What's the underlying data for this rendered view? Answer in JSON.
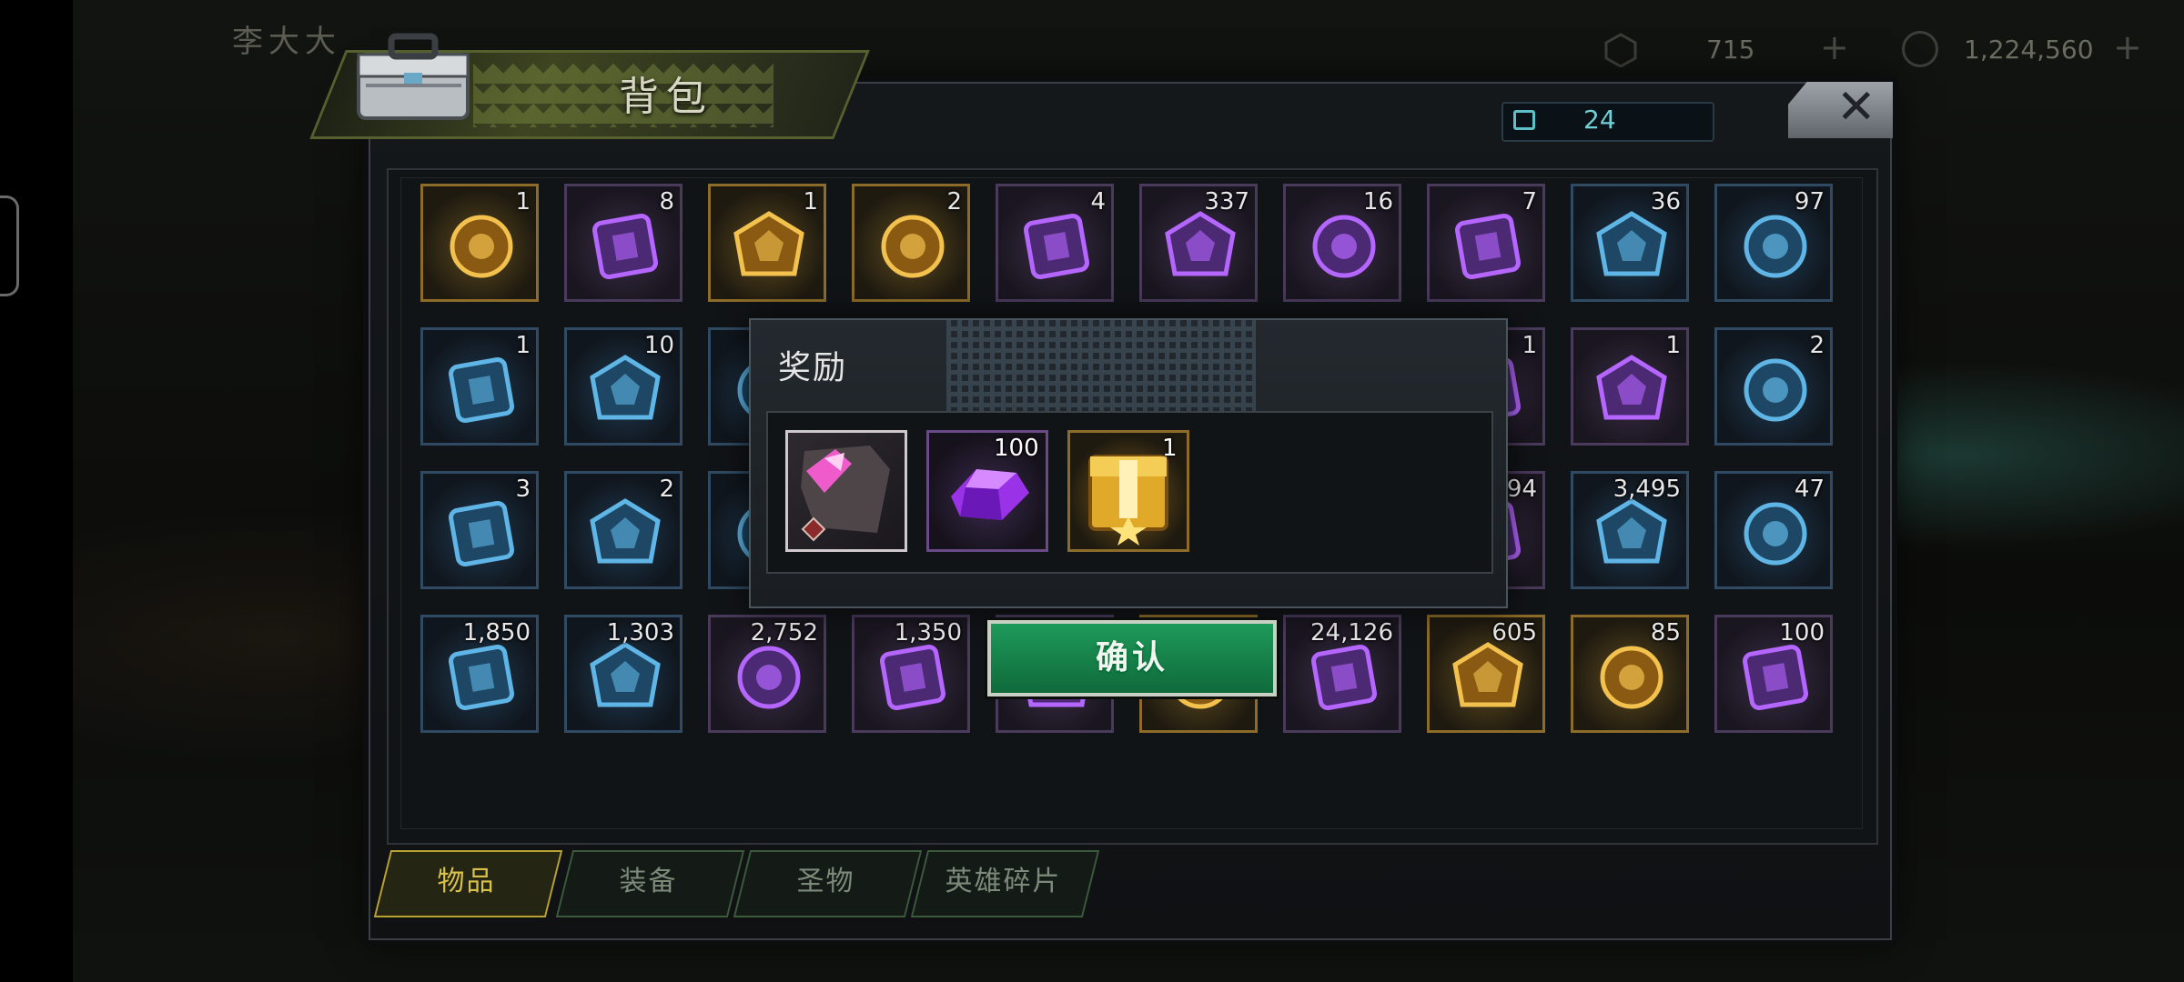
{
  "background": {
    "player_name": "李大大",
    "resources": [
      {
        "name": "energy",
        "value": "715",
        "icon": "hexagon-icon"
      },
      {
        "name": "coins",
        "value": "1,224,560",
        "icon": "coin-icon"
      }
    ]
  },
  "panel": {
    "title": "背包",
    "capacity": "24",
    "close_icon": "close-icon"
  },
  "items": [
    {
      "qty": "1",
      "icon": "lv1-crate-icon",
      "rarity": "gold"
    },
    {
      "qty": "8",
      "icon": "robot-drone-icon",
      "rarity": "purple"
    },
    {
      "qty": "1",
      "icon": "golden-chest-icon",
      "rarity": "gold"
    },
    {
      "qty": "2",
      "icon": "24h-speedup-card-icon",
      "rarity": "gold"
    },
    {
      "qty": "4",
      "icon": "12h-speedup-card-icon",
      "rarity": "purple"
    },
    {
      "qty": "337",
      "icon": "fish-icon",
      "rarity": "purple"
    },
    {
      "qty": "16",
      "icon": "film-reel-icon",
      "rarity": "purple"
    },
    {
      "qty": "7",
      "icon": "police-badge-icon",
      "rarity": "purple"
    },
    {
      "qty": "36",
      "icon": "snowball-icon",
      "rarity": "blue"
    },
    {
      "qty": "97",
      "icon": "cinema-ticket-icon",
      "rarity": "blue"
    },
    {
      "qty": "1",
      "icon": "timer-token-icon",
      "rarity": "blue"
    },
    {
      "qty": "10",
      "icon": "bottle-cap-icon",
      "rarity": "blue"
    },
    {
      "qty": "",
      "icon": "hidden-item-icon",
      "rarity": "blue"
    },
    {
      "qty": "1",
      "icon": "blueprint-hat-icon",
      "rarity": "purple"
    },
    {
      "qty": "1",
      "icon": "blueprint-hat-icon",
      "rarity": "purple"
    },
    {
      "qty": "2",
      "icon": "blueprint-cowboy-hat-icon",
      "rarity": "blue"
    },
    {
      "qty": "3",
      "icon": "blueprint-shirt-icon",
      "rarity": "blue"
    },
    {
      "qty": "2",
      "icon": "blueprint-boot-icon",
      "rarity": "blue"
    },
    {
      "qty": "",
      "icon": "hidden-item-icon",
      "rarity": "blue"
    },
    {
      "qty": "94",
      "icon": "purple-gear-icon",
      "rarity": "purple"
    },
    {
      "qty": "3,495",
      "icon": "gear-icon",
      "rarity": "blue"
    },
    {
      "qty": "47",
      "icon": "red-share-orb-icon",
      "rarity": "blue"
    },
    {
      "qty": "1,850",
      "icon": "wing-emblem-icon",
      "rarity": "blue"
    },
    {
      "qty": "1,303",
      "icon": "prism-icon",
      "rarity": "blue"
    },
    {
      "qty": "2,752",
      "icon": "fist-icon",
      "rarity": "purple"
    },
    {
      "qty": "1,350",
      "icon": "puzzle-piece-icon",
      "rarity": "purple"
    },
    {
      "qty": "",
      "icon": "hidden-item-icon",
      "rarity": "purple"
    },
    {
      "qty": "",
      "icon": "hidden-item-icon",
      "rarity": "gold"
    },
    {
      "qty": "24,126",
      "icon": "biohazard-crate-icon",
      "rarity": "purple"
    },
    {
      "qty": "605",
      "icon": "crystal-ore-icon",
      "rarity": "gold"
    },
    {
      "qty": "85",
      "icon": "gold-coins-icon",
      "rarity": "gold"
    },
    {
      "qty": "100",
      "icon": "dna-icon",
      "rarity": "purple"
    }
  ],
  "tabs": [
    {
      "label": "物品",
      "active": true
    },
    {
      "label": "装备",
      "active": false
    },
    {
      "label": "圣物",
      "active": false
    },
    {
      "label": "英雄碎片",
      "active": false
    }
  ],
  "reward_dialog": {
    "title": "奖励",
    "rewards": [
      {
        "qty": "",
        "icon": "pink-crystal-shard-icon"
      },
      {
        "qty": "100",
        "icon": "purple-gem-icon"
      },
      {
        "qty": "1",
        "icon": "golden-chest-icon"
      }
    ],
    "confirm_label": "确认"
  },
  "colors": {
    "accent_green": "#1e9a5a",
    "tab_active": "#d8c24a",
    "capacity": "#6fd0d6",
    "rarity_gold": "#8c6c28",
    "rarity_purple": "#4a3a5c",
    "rarity_blue": "#2f4a62"
  }
}
